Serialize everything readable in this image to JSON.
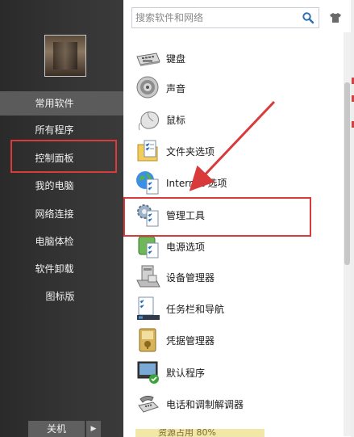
{
  "search": {
    "placeholder": "搜索软件和网络"
  },
  "sidebar": {
    "items": [
      {
        "label": "常用软件",
        "active": true
      },
      {
        "label": "所有程序"
      },
      {
        "label": "控制面板",
        "highlighted": true
      },
      {
        "label": "我的电脑"
      },
      {
        "label": "网络连接"
      },
      {
        "label": "电脑体检"
      },
      {
        "label": "软件卸载"
      },
      {
        "label": "图标版"
      }
    ],
    "power_label": "关机",
    "power_arrow": "▶"
  },
  "control_panel": {
    "items": [
      {
        "label": "键盘",
        "icon": "keyboard-icon"
      },
      {
        "label": "声音",
        "icon": "speaker-icon"
      },
      {
        "label": "鼠标",
        "icon": "mouse-icon"
      },
      {
        "label": "文件夹选项",
        "icon": "folder-options-icon"
      },
      {
        "label": "Internet 选项",
        "icon": "internet-options-icon"
      },
      {
        "label": "管理工具",
        "icon": "admin-tools-icon",
        "highlighted": true
      },
      {
        "label": "电源选项",
        "icon": "power-options-icon"
      },
      {
        "label": "设备管理器",
        "icon": "device-manager-icon"
      },
      {
        "label": "任务栏和导航",
        "icon": "taskbar-icon"
      },
      {
        "label": "凭据管理器",
        "icon": "credential-manager-icon"
      },
      {
        "label": "默认程序",
        "icon": "default-programs-icon"
      },
      {
        "label": "电话和调制解调器",
        "icon": "phone-modem-icon"
      }
    ]
  },
  "status": {
    "text": "资源占用 80%"
  },
  "colors": {
    "highlight": "#d93b3b",
    "sidebar_bg": "#333333",
    "active_item": "#5b5b5b"
  }
}
